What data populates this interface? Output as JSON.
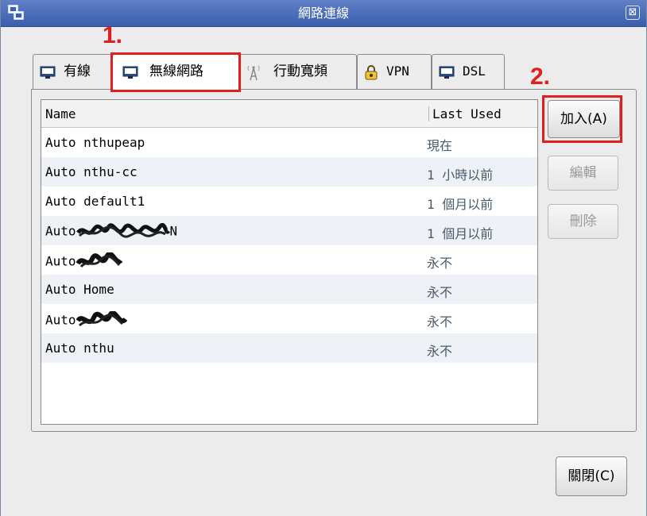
{
  "window": {
    "title": "網路連線",
    "close_glyph": "⊠"
  },
  "tabs": [
    {
      "label": "有線",
      "icon": "monitor-icon"
    },
    {
      "label": "無線網路",
      "icon": "monitor-icon"
    },
    {
      "label": "行動寬頻",
      "icon": "antenna-icon"
    },
    {
      "label": "VPN",
      "icon": "lock-icon"
    },
    {
      "label": "DSL",
      "icon": "monitor-icon"
    }
  ],
  "active_tab": "無線網路",
  "table": {
    "columns": [
      "Name",
      "Last Used"
    ],
    "rows": [
      {
        "name": "Auto nthupeap",
        "last_used": "現在"
      },
      {
        "name": "Auto nthu-cc",
        "last_used": "1 小時以前"
      },
      {
        "name": "Auto default1",
        "last_used": "1 個月以前"
      },
      {
        "name": "Auto",
        "name_suffix": "N",
        "last_used": "1 個月以前"
      },
      {
        "name": "Auto",
        "last_used": "永不"
      },
      {
        "name": "Auto Home",
        "last_used": "永不"
      },
      {
        "name": "Auto",
        "last_used": "永不"
      },
      {
        "name": "Auto nthu",
        "last_used": "永不"
      }
    ]
  },
  "buttons": {
    "add": "加入(A)",
    "edit": "編輯",
    "delete": "刪除",
    "close": "關閉(C)"
  },
  "annotations": {
    "step1": "1.",
    "step2": "2."
  },
  "colors": {
    "titlebar": "#4a6fbe",
    "highlight": "#e01f1f",
    "disabled_text": "#9a9a9a"
  }
}
